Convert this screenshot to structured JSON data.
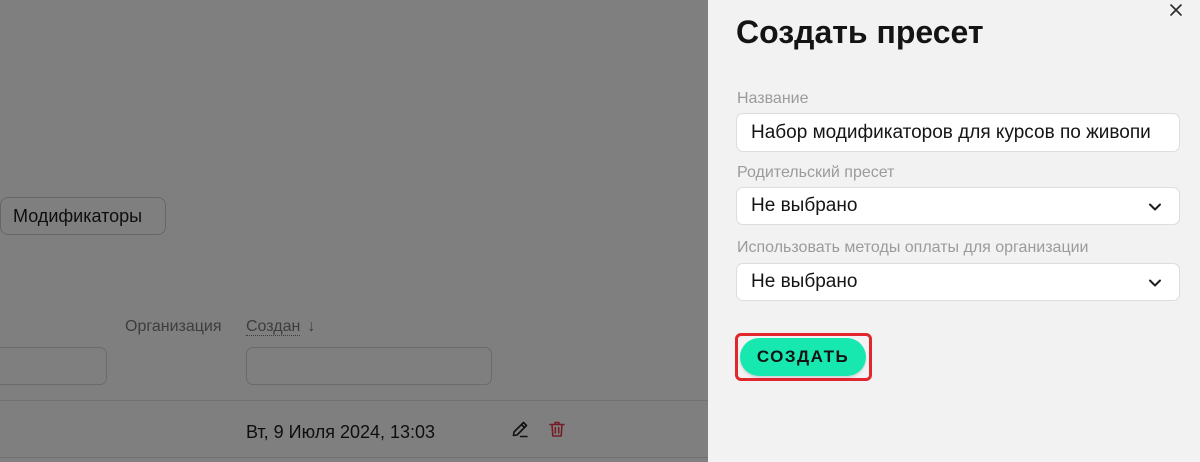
{
  "backdrop_page": {
    "modifiers_button": {
      "label": "Модификаторы"
    },
    "table": {
      "columns": {
        "organization": {
          "label": "Организация"
        },
        "created": {
          "label": "Создан",
          "sort_glyph": "↓",
          "sort_icon": "arrow-down-icon"
        }
      },
      "filters": {
        "left": {
          "value": ""
        },
        "created": {
          "value": ""
        }
      },
      "rows": [
        {
          "created": "Вт, 9 Июля 2024, 13:03",
          "edit_icon": "pencil-icon",
          "delete_icon": "trash-icon"
        }
      ]
    }
  },
  "drawer": {
    "title": "Создать пресет",
    "close_icon": "close-icon",
    "fields": [
      {
        "label": "Название",
        "value": "Набор модификаторов для курсов по живопи"
      },
      {
        "label": "Родительский пресет",
        "value": "Не выбрано",
        "icon": "chevron-down-icon"
      },
      {
        "label": "Использовать методы оплаты для организации",
        "value": "Не выбрано",
        "icon": "chevron-down-icon"
      }
    ],
    "submit_button": {
      "label": "СОЗДАТЬ"
    }
  },
  "colors": {
    "accent": "#17e8b0",
    "highlight": "#e2262e",
    "danger": "#e83a4e",
    "drawer_background": "#f2f2f2"
  }
}
